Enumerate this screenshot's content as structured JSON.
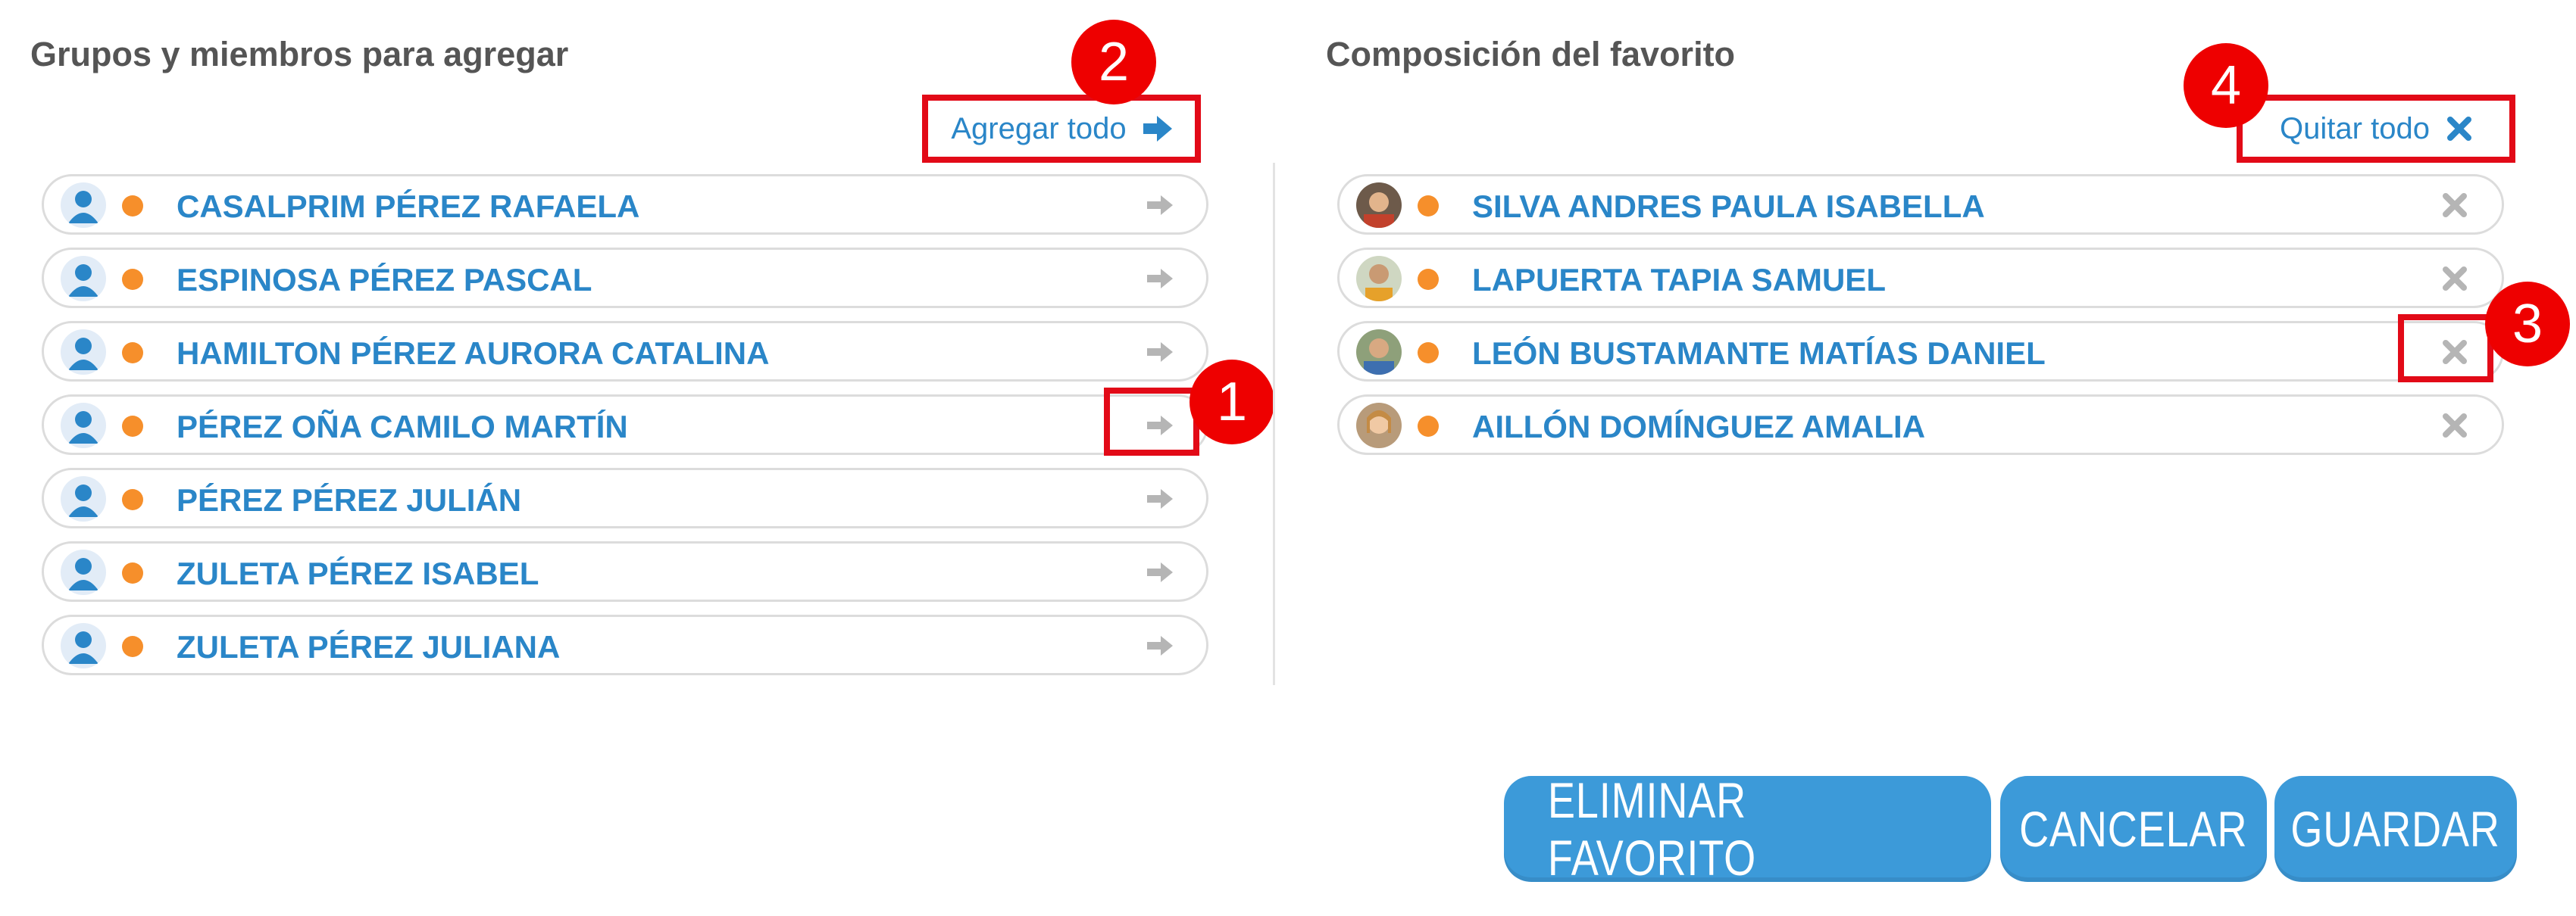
{
  "left_panel": {
    "title": "Grupos y miembros para agregar",
    "add_all_label": "Agregar todo",
    "members": [
      {
        "name": "CASALPRIM PÉREZ RAFAELA"
      },
      {
        "name": "ESPINOSA PÉREZ PASCAL"
      },
      {
        "name": "HAMILTON PÉREZ AURORA CATALINA"
      },
      {
        "name": "PÉREZ OÑA CAMILO MARTÍN"
      },
      {
        "name": "PÉREZ PÉREZ JULIÁN"
      },
      {
        "name": "ZULETA PÉREZ ISABEL"
      },
      {
        "name": "ZULETA PÉREZ JULIANA"
      }
    ]
  },
  "right_panel": {
    "title": "Composición del favorito",
    "remove_all_label": "Quitar todo",
    "members": [
      {
        "name": "SILVA ANDRES PAULA ISABELLA"
      },
      {
        "name": "LAPUERTA TAPIA SAMUEL"
      },
      {
        "name": "LEÓN BUSTAMANTE MATÍAS DANIEL"
      },
      {
        "name": "AILLÓN DOMÍNGUEZ AMALIA"
      }
    ]
  },
  "callouts": {
    "one": "1",
    "two": "2",
    "three": "3",
    "four": "4"
  },
  "buttons": {
    "delete": "ELIMINAR FAVORITO",
    "cancel": "CANCELAR",
    "save": "GUARDAR"
  },
  "colors": {
    "accent": "#2a86c8",
    "status_dot": "#f68f2b",
    "button": "#3c9ad9",
    "highlight": "#e20a17"
  },
  "icons": {
    "row_add": "arrow-right-icon",
    "row_remove": "close-icon",
    "avatar": "user-icon"
  }
}
